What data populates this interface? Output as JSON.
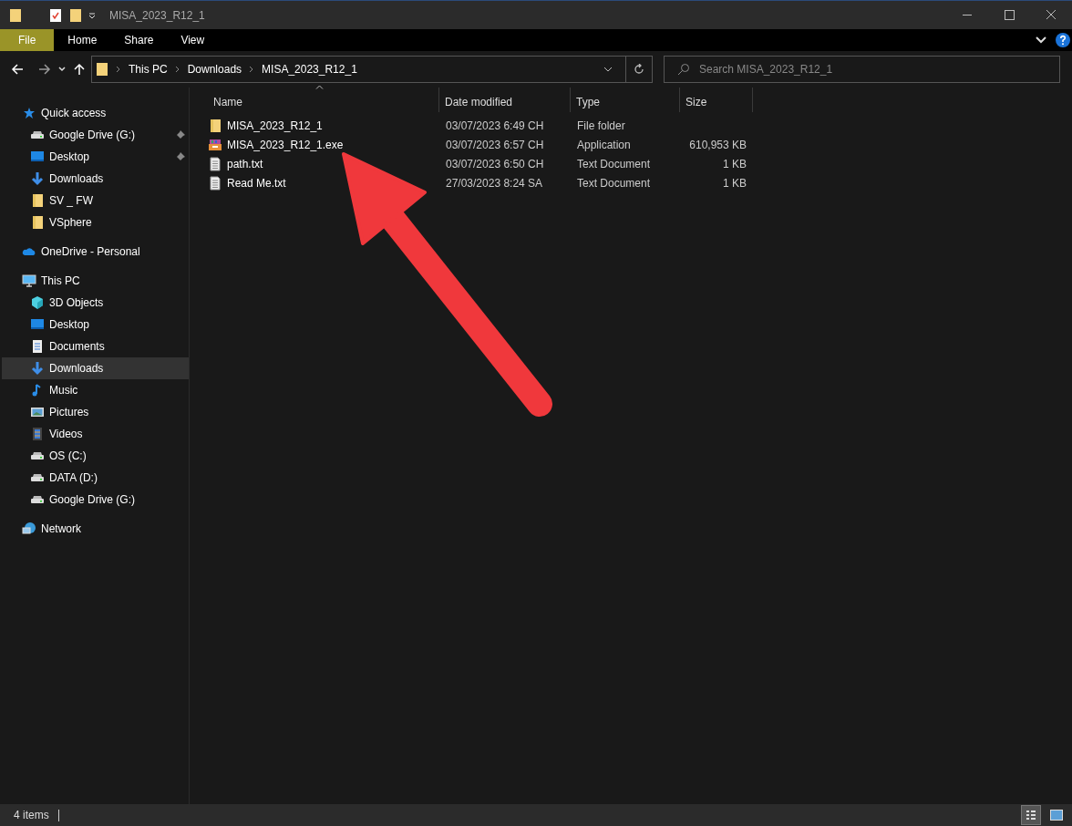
{
  "window": {
    "title": "MISA_2023_R12_1"
  },
  "ribbon": {
    "tabs": [
      {
        "label": "File",
        "selected": true
      },
      {
        "label": "Home",
        "selected": false
      },
      {
        "label": "Share",
        "selected": false
      },
      {
        "label": "View",
        "selected": false
      }
    ]
  },
  "address": {
    "crumbs": [
      "This PC",
      "Downloads",
      "MISA_2023_R12_1"
    ]
  },
  "search": {
    "placeholder": "Search MISA_2023_R12_1"
  },
  "sidebar": {
    "sections": [
      {
        "label": "Quick access",
        "kind": "star",
        "selected": false,
        "children": [
          {
            "label": "Google Drive (G:)",
            "kind": "drive",
            "pinned": true,
            "selected": false
          },
          {
            "label": "Desktop",
            "kind": "desktop",
            "pinned": true,
            "selected": false
          },
          {
            "label": "Downloads",
            "kind": "download",
            "pinned": false,
            "selected": false
          },
          {
            "label": "SV _ FW",
            "kind": "folder",
            "pinned": false,
            "selected": false
          },
          {
            "label": "VSphere",
            "kind": "folder",
            "pinned": false,
            "selected": false
          }
        ]
      },
      {
        "label": "OneDrive - Personal",
        "kind": "cloud",
        "selected": false
      },
      {
        "label": "This PC",
        "kind": "pc",
        "selected": false,
        "children": [
          {
            "label": "3D Objects",
            "kind": "cube",
            "pinned": false,
            "selected": false
          },
          {
            "label": "Desktop",
            "kind": "desktop",
            "pinned": false,
            "selected": false
          },
          {
            "label": "Documents",
            "kind": "document",
            "pinned": false,
            "selected": false
          },
          {
            "label": "Downloads",
            "kind": "download",
            "pinned": false,
            "selected": true
          },
          {
            "label": "Music",
            "kind": "music",
            "pinned": false,
            "selected": false
          },
          {
            "label": "Pictures",
            "kind": "picture",
            "pinned": false,
            "selected": false
          },
          {
            "label": "Videos",
            "kind": "video",
            "pinned": false,
            "selected": false
          },
          {
            "label": "OS (C:)",
            "kind": "drive",
            "pinned": false,
            "selected": false
          },
          {
            "label": "DATA (D:)",
            "kind": "drive",
            "pinned": false,
            "selected": false
          },
          {
            "label": "Google Drive (G:)",
            "kind": "drive",
            "pinned": false,
            "selected": false
          }
        ]
      },
      {
        "label": "Network",
        "kind": "network",
        "selected": false
      }
    ]
  },
  "table": {
    "columns": [
      "Name",
      "Date modified",
      "Type",
      "Size"
    ],
    "rows": [
      {
        "kind": "folder",
        "name": "MISA_2023_R12_1",
        "date": "03/07/2023 6:49 CH",
        "type": "File folder",
        "size": ""
      },
      {
        "kind": "app",
        "name": "MISA_2023_R12_1.exe",
        "date": "03/07/2023 6:57 CH",
        "type": "Application",
        "size": "610,953 KB"
      },
      {
        "kind": "text",
        "name": "path.txt",
        "date": "03/07/2023 6:50 CH",
        "type": "Text Document",
        "size": "1 KB"
      },
      {
        "kind": "text",
        "name": "Read Me.txt",
        "date": "27/03/2023 8:24 SA",
        "type": "Text Document",
        "size": "1 KB"
      }
    ]
  },
  "status_bar": {
    "count": "4 items",
    "views": [
      {
        "selected": true
      },
      {
        "selected": false
      }
    ]
  }
}
